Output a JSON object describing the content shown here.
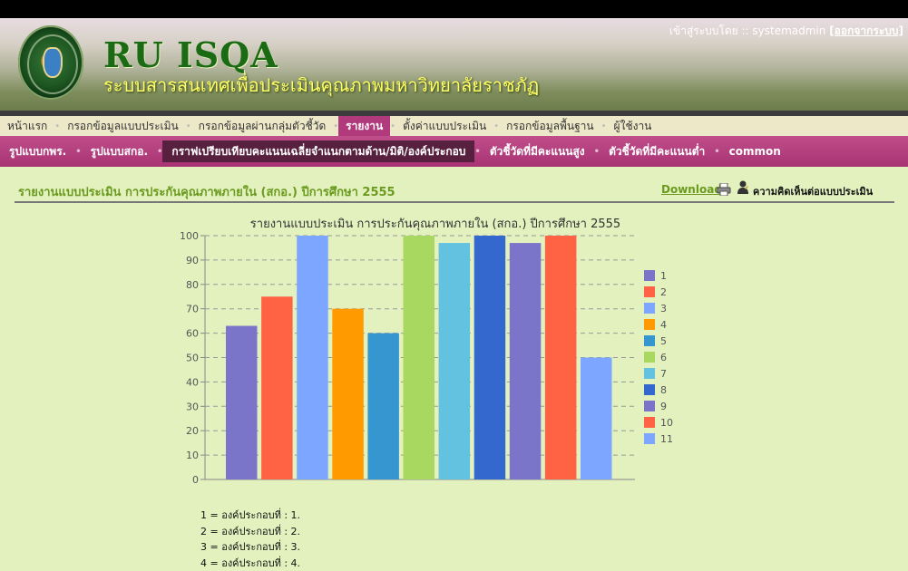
{
  "header": {
    "title": "RU ISQA",
    "subtitle": "ระบบสารสนเทศเพื่อประเมินคุณภาพมหาวิทยาลัยราชภัฏ",
    "user_prefix": "เข้าสู่ระบบโดย :: systemadmin ",
    "logout": "[ออกจากระบบ]"
  },
  "main_nav": {
    "items": [
      {
        "label": "หน้าแรก"
      },
      {
        "label": "กรอกข้อมูลแบบประเมิน"
      },
      {
        "label": "กรอกข้อมูลผ่านกลุ่มตัวชี้วัด"
      },
      {
        "label": "รายงาน",
        "active": true
      },
      {
        "label": "ตั้งค่าแบบประเมิน"
      },
      {
        "label": "กรอกข้อมูลพื้นฐาน"
      },
      {
        "label": "ผู้ใช้งาน"
      }
    ]
  },
  "sub_nav": {
    "items": [
      {
        "label": "รูปแบบกพร."
      },
      {
        "label": "รูปแบบสกอ."
      },
      {
        "label": "กราฟเปรียบเทียบคะแนนเฉลี่ยจำแนกตามด้าน/มิติ/องค์ประกอบ",
        "active": true
      },
      {
        "label": "ตัวชี้วัดที่มีคะแนนสูง"
      },
      {
        "label": "ตัวชี้วัดที่มีคะแนนต่ำ"
      },
      {
        "label": "common"
      }
    ]
  },
  "report": {
    "title": "รายงานแบบประเมิน การประกันคุณภาพภายใน (สกอ.) ปีการศึกษา 2555",
    "download": "Download",
    "comment": "ความคิดเห็นต่อแบบประเมิน"
  },
  "icons": {
    "printer": "printer-icon",
    "comment": "user-comment-icon"
  },
  "chart_data": {
    "type": "bar",
    "title": "รายงานแบบประเมิน การประกันคุณภาพภายใน (สกอ.) ปีการศึกษา 2555",
    "ylim": [
      0,
      100
    ],
    "yticks": [
      0,
      10,
      20,
      30,
      40,
      50,
      60,
      70,
      80,
      90,
      100
    ],
    "grid": true,
    "legend_position": "right",
    "series": [
      {
        "name": "1",
        "value": 63,
        "color": "#7b75c9"
      },
      {
        "name": "2",
        "value": 75,
        "color": "#ff6344"
      },
      {
        "name": "3",
        "value": 100,
        "color": "#7ca6ff"
      },
      {
        "name": "4",
        "value": 70,
        "color": "#ff9a00"
      },
      {
        "name": "5",
        "value": 60,
        "color": "#3596d0"
      },
      {
        "name": "6",
        "value": 100,
        "color": "#a8d860"
      },
      {
        "name": "7",
        "value": 97,
        "color": "#62c2e0"
      },
      {
        "name": "8",
        "value": 100,
        "color": "#3568cf"
      },
      {
        "name": "9",
        "value": 97,
        "color": "#7b75c9"
      },
      {
        "name": "10",
        "value": 100,
        "color": "#ff6344"
      },
      {
        "name": "11",
        "value": 50,
        "color": "#7ca6ff"
      }
    ]
  },
  "notes": [
    "1 = องค์ประกอบที่ : 1.",
    "2 = องค์ประกอบที่ : 2.",
    "3 = องค์ประกอบที่ : 3.",
    "4 = องค์ประกอบที่ : 4."
  ]
}
